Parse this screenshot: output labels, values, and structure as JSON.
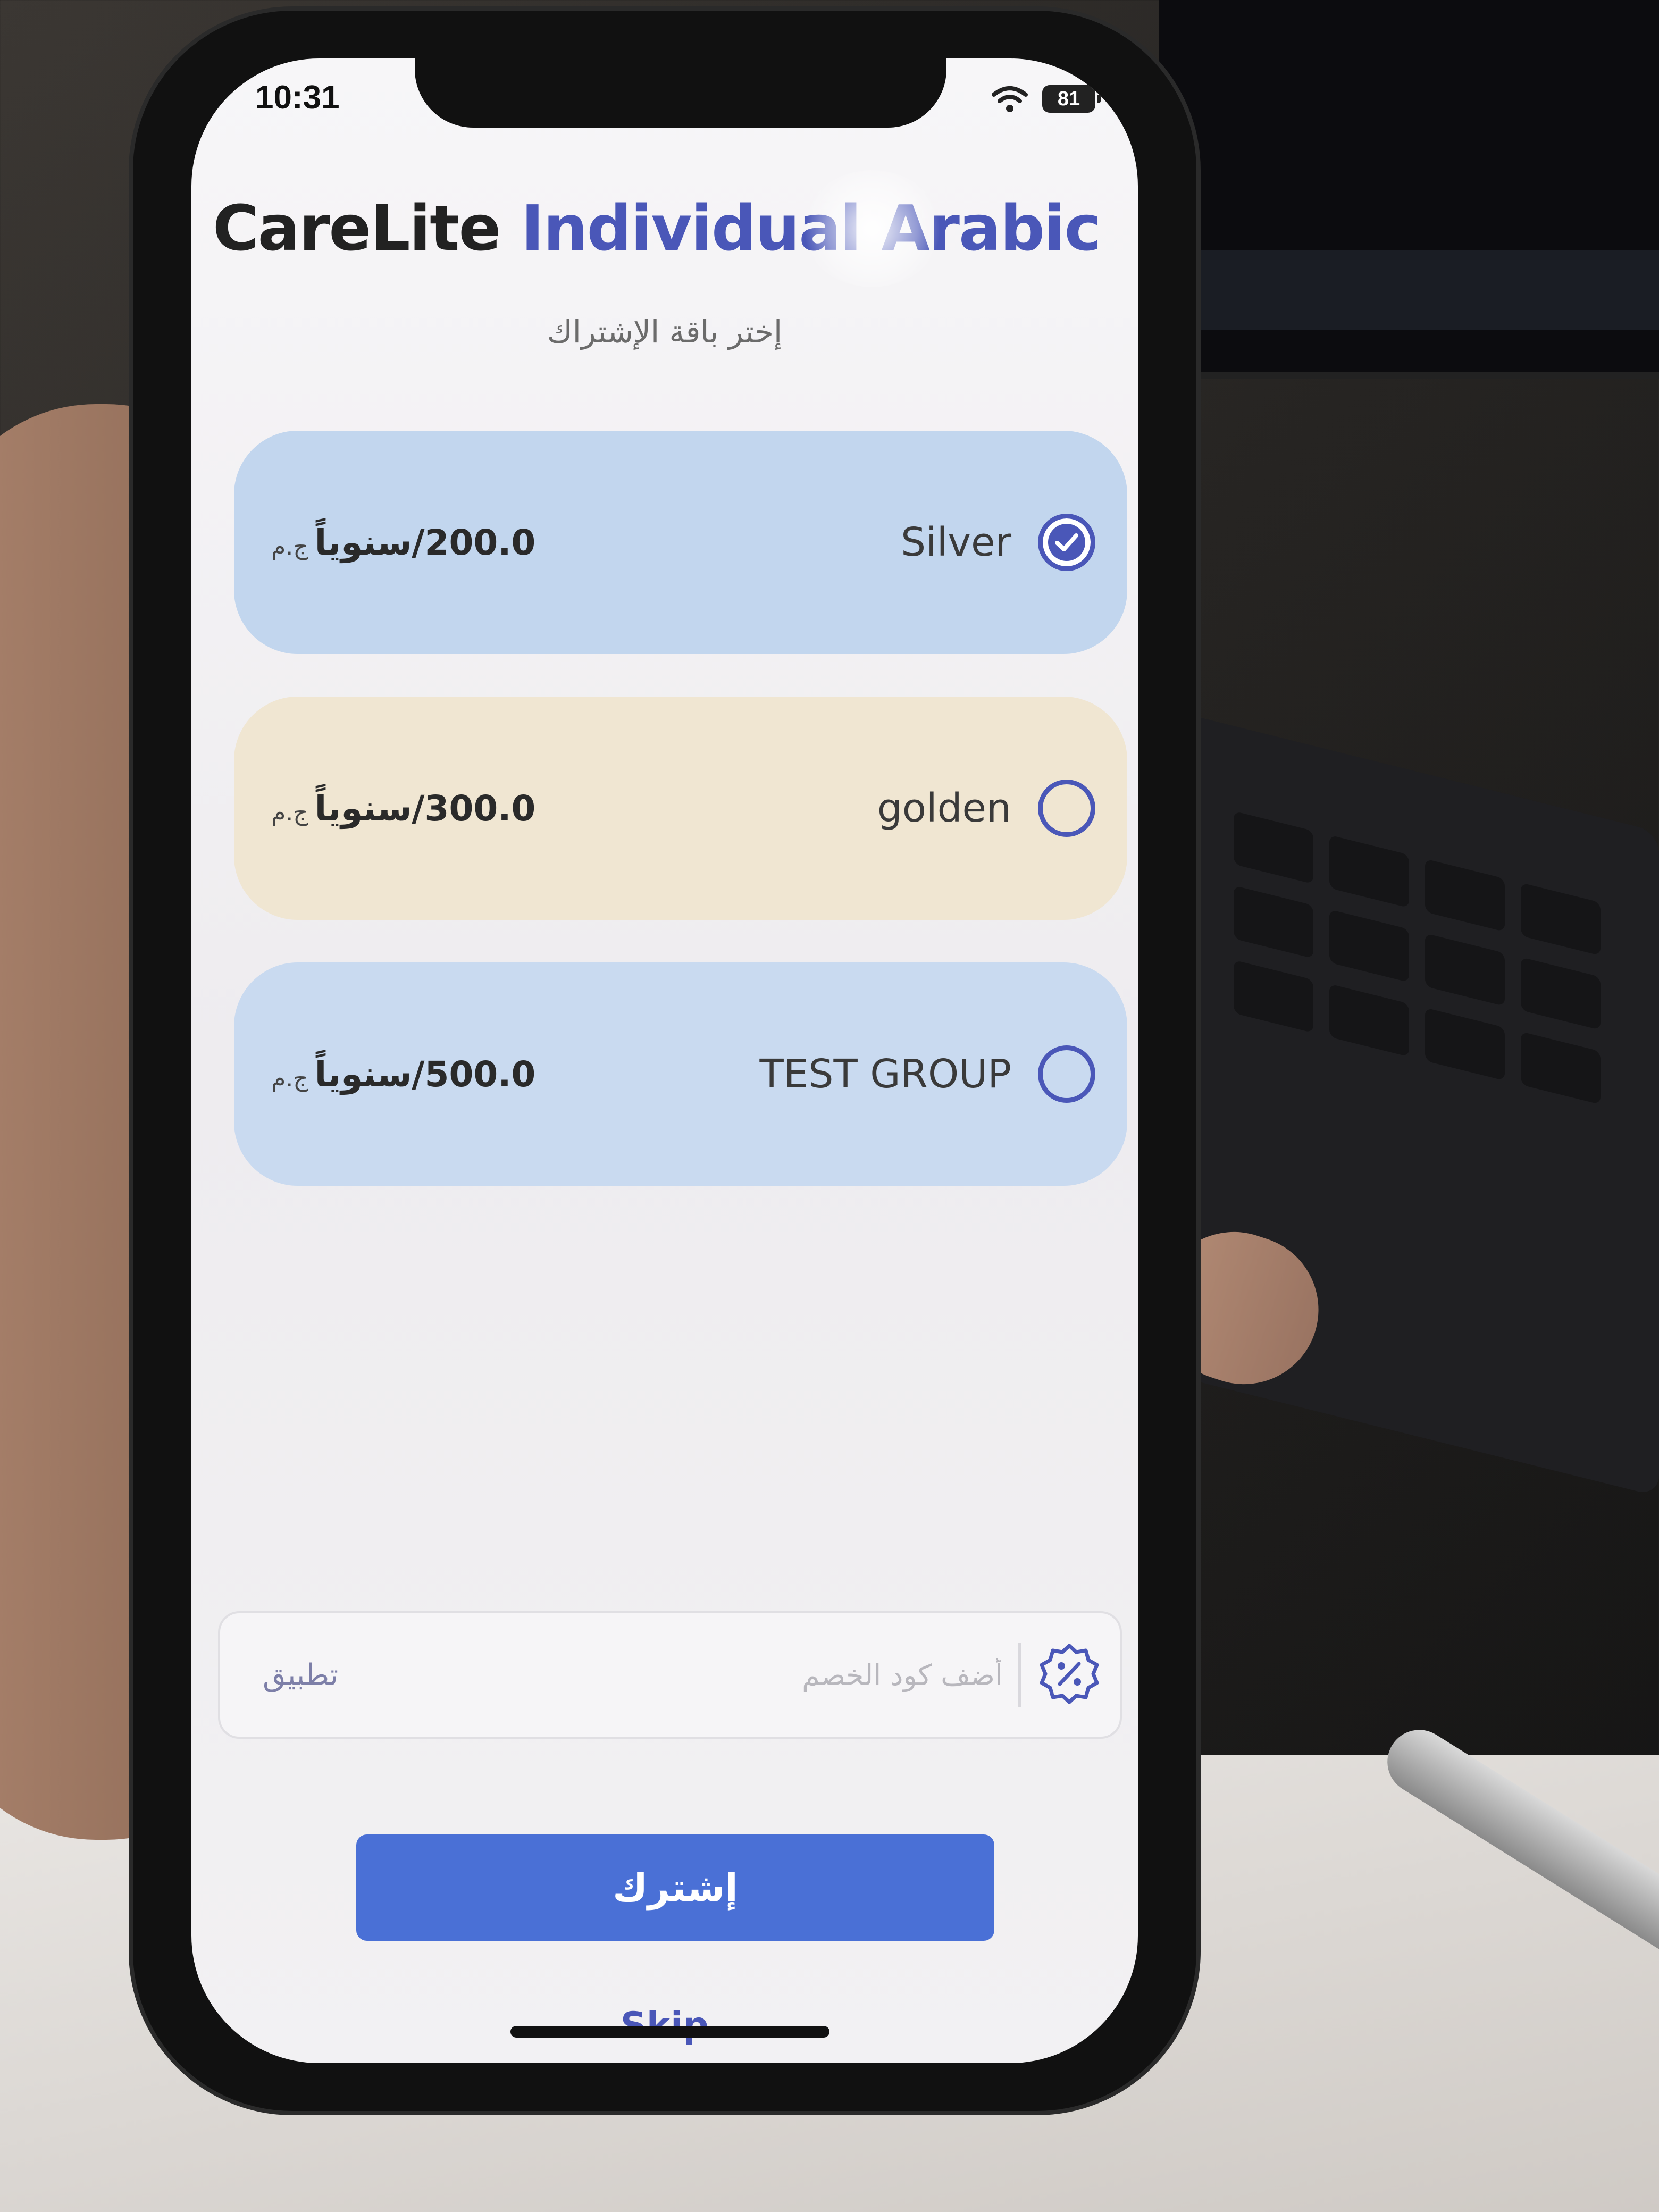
{
  "status_bar": {
    "time": "10:31",
    "battery": "81"
  },
  "header": {
    "title_brand": "CareLite",
    "title_variant": "Individual Arabic",
    "subtitle": "إختر باقة الإشتراك"
  },
  "plans": [
    {
      "name": "Silver",
      "price": "200.0/سنوياً",
      "currency": "ج.م",
      "selected": true,
      "card_color": "#c2d6ee"
    },
    {
      "name": "golden",
      "price": "300.0/سنوياً",
      "currency": "ج.م",
      "selected": false,
      "card_color": "#f0e6d2"
    },
    {
      "name": "TEST GROUP",
      "price": "500.0/سنوياً",
      "currency": "ج.م",
      "selected": false,
      "card_color": "#c9daf0"
    }
  ],
  "coupon": {
    "placeholder": "أضف كود الخصم",
    "apply_label": "تطبيق",
    "icon": "discount-badge-icon"
  },
  "actions": {
    "subscribe_label": "إشترك",
    "skip_label": "Skip"
  },
  "colors": {
    "accent": "#4a57b8",
    "button": "#4a70d6"
  }
}
